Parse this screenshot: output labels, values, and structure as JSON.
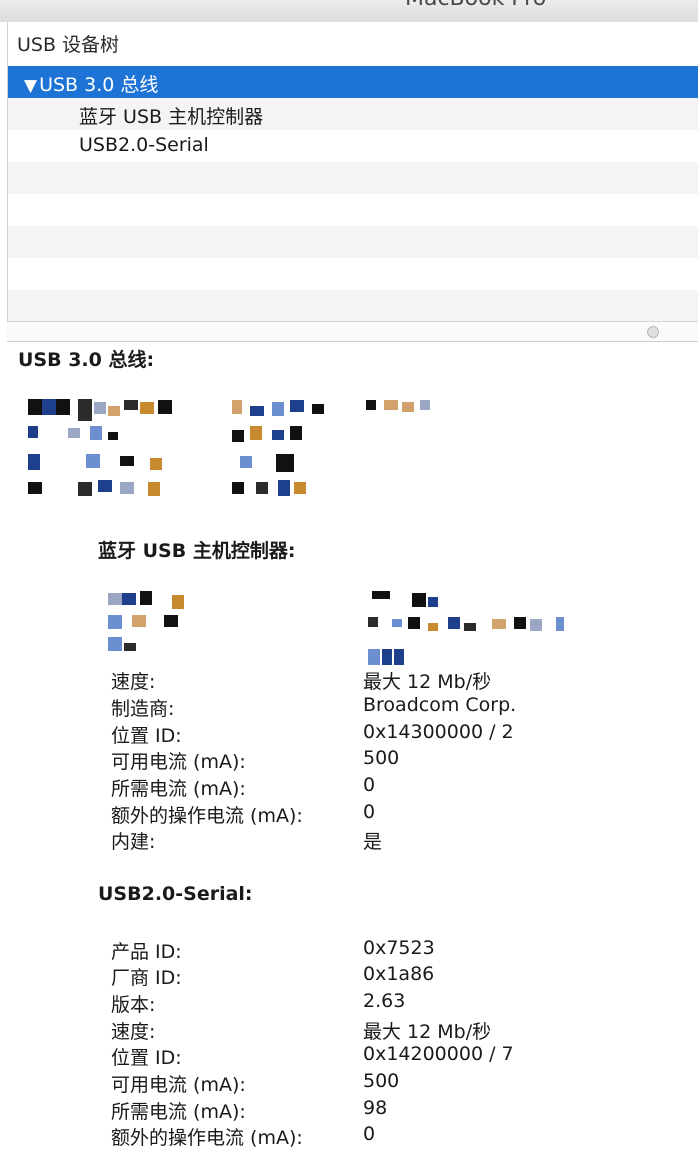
{
  "window": {
    "title": "MacBook Pro"
  },
  "tree": {
    "header": "USB 设备树",
    "items": [
      {
        "label": "USB 3.0 总线",
        "expanded": true,
        "selected": true
      },
      {
        "label": "蓝牙 USB 主机控制器"
      },
      {
        "label": "USB2.0-Serial"
      }
    ]
  },
  "detail": {
    "title": "USB 3.0 总线:",
    "devices": [
      {
        "title": "蓝牙 USB 主机控制器:",
        "props": [
          {
            "key": "速度:",
            "value": "最大 12 Mb/秒"
          },
          {
            "key": "制造商:",
            "value": "Broadcom Corp."
          },
          {
            "key": "位置 ID:",
            "value": "0x14300000 / 2"
          },
          {
            "key": "可用电流 (mA):",
            "value": "500"
          },
          {
            "key": "所需电流 (mA):",
            "value": "0"
          },
          {
            "key": "额外的操作电流 (mA):",
            "value": "0"
          },
          {
            "key": "内建:",
            "value": "是"
          }
        ]
      },
      {
        "title": "USB2.0-Serial:",
        "props": [
          {
            "key": "产品 ID:",
            "value": "0x7523"
          },
          {
            "key": "厂商 ID:",
            "value": "0x1a86"
          },
          {
            "key": "版本:",
            "value": "2.63"
          },
          {
            "key": "速度:",
            "value": "最大 12 Mb/秒"
          },
          {
            "key": "位置 ID:",
            "value": "0x14200000 / 7"
          },
          {
            "key": "可用电流 (mA):",
            "value": "500"
          },
          {
            "key": "所需电流 (mA):",
            "value": "98"
          },
          {
            "key": "额外的操作电流 (mA):",
            "value": "0"
          }
        ]
      }
    ]
  },
  "colors": {
    "selection": "#1d74d6",
    "stripe": "#f4f4f4",
    "pixelation": [
      "#111111",
      "#1d3f8c",
      "#d1a26b",
      "#9aa6c4",
      "#6b8fd0",
      "#2b2b2b",
      "#c9892f"
    ]
  }
}
